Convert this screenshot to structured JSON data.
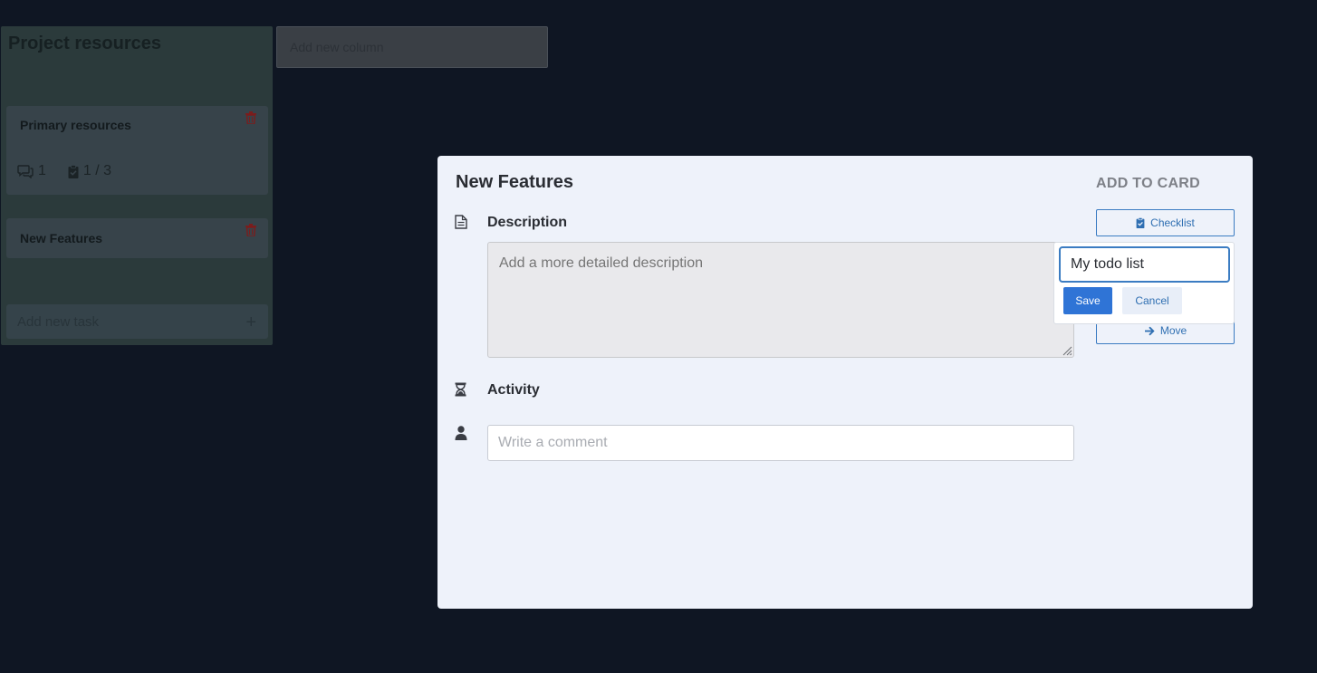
{
  "board": {
    "column": {
      "title": "Project resources",
      "cards": [
        {
          "title": "Primary resources",
          "comments": "1",
          "checklist": "1 / 3"
        },
        {
          "title": "New Features"
        }
      ],
      "add_task_placeholder": "Add new task",
      "add_task_icon": "plus-icon"
    },
    "add_column_placeholder": "Add new column"
  },
  "modal": {
    "title": "New Features",
    "description": {
      "label": "Description",
      "placeholder": "Add a more detailed description"
    },
    "activity": {
      "label": "Activity",
      "comment_placeholder": "Write a comment"
    },
    "sidebar": {
      "heading": "ADD TO CARD",
      "checklist_label": "Checklist",
      "move_label": "Move"
    },
    "checklist_popover": {
      "input_value": "My todo list",
      "save_label": "Save",
      "cancel_label": "Cancel"
    }
  },
  "colors": {
    "accent": "#3b7cc2",
    "primary_button": "#2f74d6",
    "danger": "#8a1f1f",
    "overlay_background": "#0f1623",
    "modal_background": "#eef2fa"
  }
}
